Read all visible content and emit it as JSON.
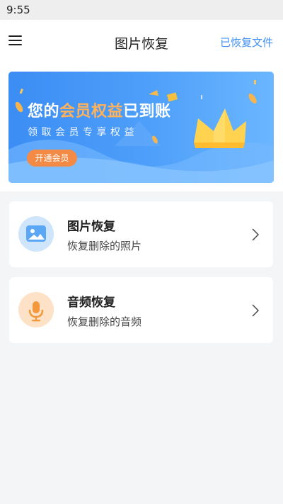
{
  "status_bar": {
    "time": "9:55"
  },
  "header": {
    "title": "图片恢复",
    "right_link": "已恢复文件",
    "menu_icon": "hamburger-menu-icon"
  },
  "banner": {
    "title_prefix": "您的",
    "title_highlight": "会员权益",
    "title_suffix": "已到账",
    "subtitle": "领取会员专享权益",
    "button_label": "开通会员",
    "icon": "crown-icon"
  },
  "cards": [
    {
      "title": "图片恢复",
      "subtitle": "恢复删除的照片",
      "icon": "image-icon",
      "color": "#5aa7f5"
    },
    {
      "title": "音频恢复",
      "subtitle": "恢复删除的音频",
      "icon": "microphone-icon",
      "color": "#f3993c"
    }
  ],
  "colors": {
    "accent": "#3f8ff3",
    "banner_button": "#f38b46",
    "highlight": "#ffb25a",
    "background": "#f4f5f7"
  }
}
